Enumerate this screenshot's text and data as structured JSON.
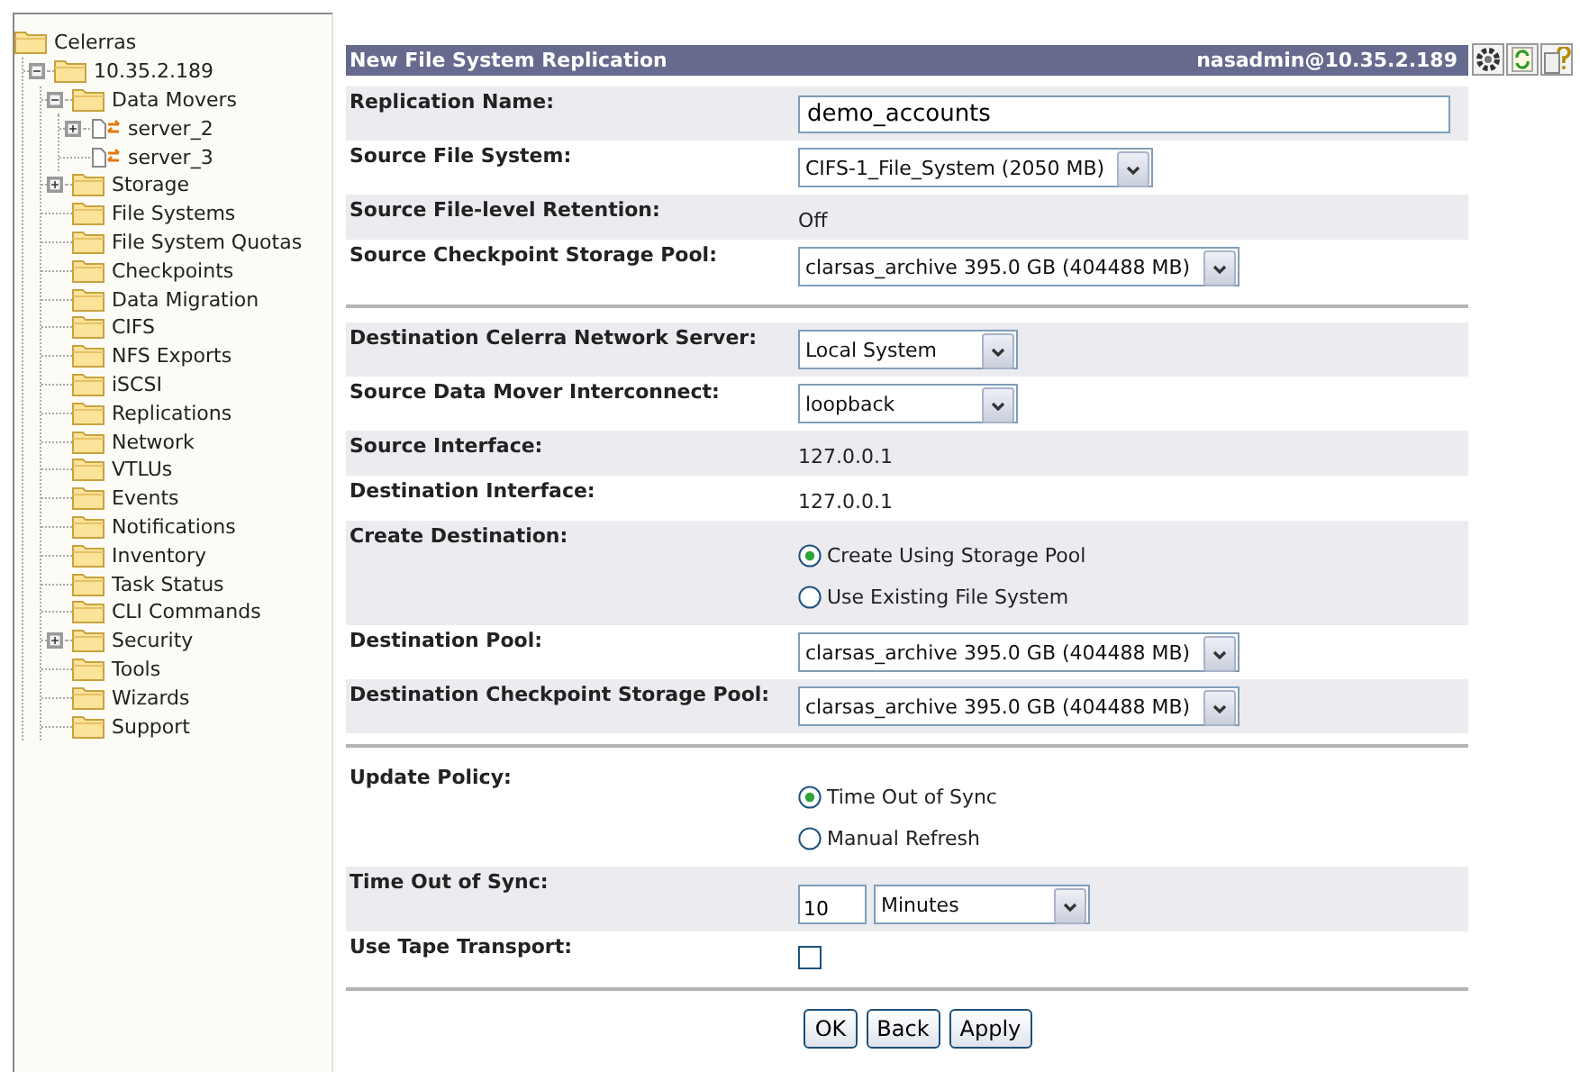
{
  "sidebar": {
    "tree": [
      {
        "label": "Celerras",
        "kind": "folder",
        "expandable": false,
        "children": [
          {
            "label": "10.35.2.189",
            "kind": "folder",
            "expandable": true,
            "expanded": true,
            "children": [
              {
                "label": "Data Movers",
                "kind": "folder",
                "expandable": true,
                "expanded": true,
                "children": [
                  {
                    "label": "server_2",
                    "kind": "mover",
                    "expandable": true,
                    "expanded": false
                  },
                  {
                    "label": "server_3",
                    "kind": "mover",
                    "expandable": false
                  }
                ]
              },
              {
                "label": "Storage",
                "kind": "folder",
                "expandable": true,
                "expanded": false
              },
              {
                "label": "File Systems",
                "kind": "folder",
                "expandable": false
              },
              {
                "label": "File System Quotas",
                "kind": "folder",
                "expandable": false
              },
              {
                "label": "Checkpoints",
                "kind": "folder",
                "expandable": false
              },
              {
                "label": "Data Migration",
                "kind": "folder",
                "expandable": false
              },
              {
                "label": "CIFS",
                "kind": "folder",
                "expandable": false
              },
              {
                "label": "NFS Exports",
                "kind": "folder",
                "expandable": false
              },
              {
                "label": "iSCSI",
                "kind": "folder",
                "expandable": false
              },
              {
                "label": "Replications",
                "kind": "folder",
                "expandable": false
              },
              {
                "label": "Network",
                "kind": "folder",
                "expandable": false
              },
              {
                "label": "VTLUs",
                "kind": "folder",
                "expandable": false
              },
              {
                "label": "Events",
                "kind": "folder",
                "expandable": false
              },
              {
                "label": "Notifications",
                "kind": "folder",
                "expandable": false
              },
              {
                "label": "Inventory",
                "kind": "folder",
                "expandable": false
              },
              {
                "label": "Task Status",
                "kind": "folder",
                "expandable": false
              },
              {
                "label": "CLI Commands",
                "kind": "folder",
                "expandable": false
              },
              {
                "label": "Security",
                "kind": "folder",
                "expandable": true,
                "expanded": false
              },
              {
                "label": "Tools",
                "kind": "folder",
                "expandable": false
              },
              {
                "label": "Wizards",
                "kind": "folder",
                "expandable": false
              },
              {
                "label": "Support",
                "kind": "folder",
                "expandable": false
              }
            ]
          }
        ]
      }
    ]
  },
  "header": {
    "title": "New File System Replication",
    "user": "nasadmin@10.35.2.189"
  },
  "form": {
    "sections": [
      {
        "rows": [
          {
            "label": "Replication Name:",
            "kind": "text",
            "value": "demo_accounts"
          },
          {
            "label": "Source File System:",
            "kind": "select",
            "value": "CIFS-1_File_System (2050 MB)"
          },
          {
            "label": "Source File-level Retention:",
            "kind": "static",
            "value": "Off"
          },
          {
            "label": "Source Checkpoint Storage Pool:",
            "kind": "select",
            "value": "clarsas_archive 395.0 GB (404488 MB)"
          }
        ]
      },
      {
        "rows": [
          {
            "label": "Destination Celerra Network Server:",
            "kind": "select",
            "value": "Local System"
          },
          {
            "label": "Source Data Mover Interconnect:",
            "kind": "select",
            "value": "loopback"
          },
          {
            "label": "Source Interface:",
            "kind": "static",
            "value": "127.0.0.1"
          },
          {
            "label": "Destination Interface:",
            "kind": "static",
            "value": "127.0.0.1"
          },
          {
            "label": "Create Destination:",
            "kind": "radio",
            "options": [
              {
                "label": "Create Using Storage Pool",
                "selected": true
              },
              {
                "label": "Use Existing File System",
                "selected": false
              }
            ]
          },
          {
            "label": "Destination Pool:",
            "kind": "select",
            "value": "clarsas_archive 395.0 GB (404488 MB)"
          },
          {
            "label": "Destination Checkpoint Storage Pool:",
            "kind": "select",
            "value": "clarsas_archive 395.0 GB (404488 MB)"
          }
        ]
      },
      {
        "rows": [
          {
            "label": "Update Policy:",
            "kind": "radio",
            "options": [
              {
                "label": "Time Out of Sync",
                "selected": true
              },
              {
                "label": "Manual Refresh",
                "selected": false
              }
            ]
          },
          {
            "label": "Time Out of Sync:",
            "kind": "number-select",
            "number": "10",
            "unit": "Minutes"
          },
          {
            "label": "Use Tape Transport:",
            "kind": "checkbox",
            "checked": false
          }
        ]
      }
    ]
  },
  "buttons": [
    "OK",
    "Back",
    "Apply"
  ]
}
